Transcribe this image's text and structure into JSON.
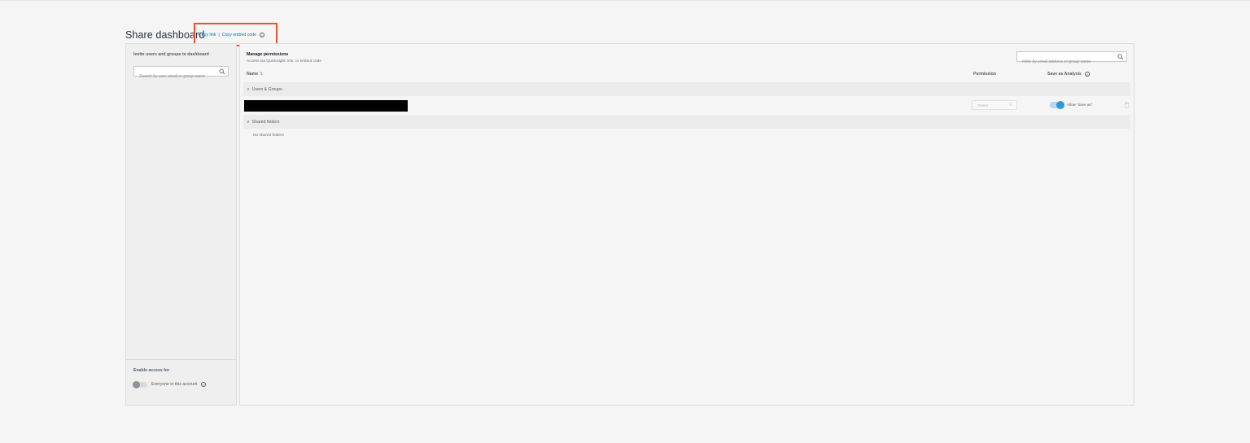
{
  "page": {
    "title": "Share dashboard",
    "copy_link": "Copy link",
    "separator": "|",
    "copy_embed": "Copy embed code",
    "info_glyph": "i"
  },
  "invite_panel": {
    "heading": "Invite users and groups to dashboard",
    "search_placeholder": "Search by user email or group name",
    "enable_heading": "Enable access for",
    "everyone_label": "Everyone in this account",
    "everyone_enabled": false
  },
  "permissions": {
    "title": "Manage permissions",
    "subtitle": "Access via QuickSight, link, or embed code",
    "filter_placeholder": "Filter by email address or group name",
    "columns": {
      "name": "Name",
      "permission": "Permission",
      "save_as": "Save as Analysis"
    },
    "groups": [
      {
        "label": "Users & Groups",
        "rows": [
          {
            "name": "",
            "permission": "Owner",
            "allow_save_as": true,
            "allow_label": "Allow \"save as\""
          }
        ]
      },
      {
        "label": "Shared folders",
        "empty_text": "No shared folders"
      }
    ]
  },
  "colors": {
    "accent": "#0073bb",
    "highlight_border": "#e4552d",
    "toggle_on": "#2d9ad9"
  },
  "icons": [
    "search-icon",
    "info-icon",
    "sort-icon",
    "chevron-down-icon",
    "trash-icon"
  ]
}
